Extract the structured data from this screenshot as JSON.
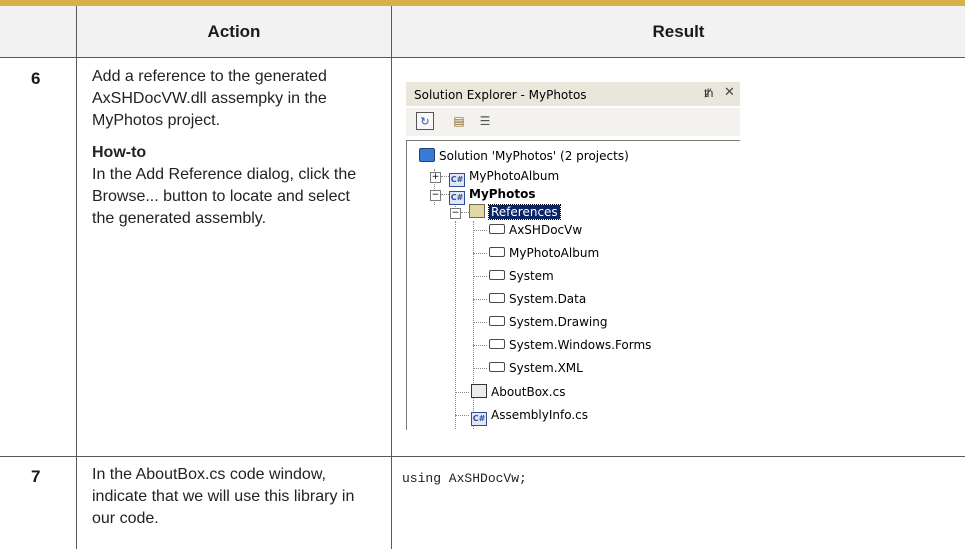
{
  "table": {
    "headers": {
      "col_action": "Action",
      "col_result": "Result"
    },
    "rows": [
      {
        "step": "6",
        "action_main": "Add a reference to the generated AxSHDocVW.dll assempky in the MyPhotos project.",
        "howto_label": "How-to",
        "howto_text": "In the Add Reference dialog, click the Browse... button to locate and select the generated assembly."
      },
      {
        "step": "7",
        "action_main": "In the AboutBox.cs code window, indicate that we will use this library in our code.",
        "code": "using AxSHDocVw;"
      }
    ]
  },
  "solution_explorer": {
    "title": "Solution Explorer - MyPhotos",
    "pin_icon": "pin-icon",
    "close_icon": "close-icon",
    "toolbar": [
      "refresh-icon",
      "properties-icon",
      "show-all-files-icon"
    ],
    "tree": {
      "solution": "Solution 'MyPhotos' (2 projects)",
      "project1": "MyPhotoAlbum",
      "project2": "MyPhotos",
      "references_folder": "References",
      "references": [
        "AxSHDocVw",
        "MyPhotoAlbum",
        "System",
        "System.Data",
        "System.Drawing",
        "System.Windows.Forms",
        "System.XML"
      ],
      "files": [
        "AboutBox.cs",
        "AssemblyInfo.cs"
      ]
    }
  },
  "colors": {
    "top_rule": "#d9b04a",
    "header_band": "#f2f2f2",
    "selection": "#0a246a"
  }
}
